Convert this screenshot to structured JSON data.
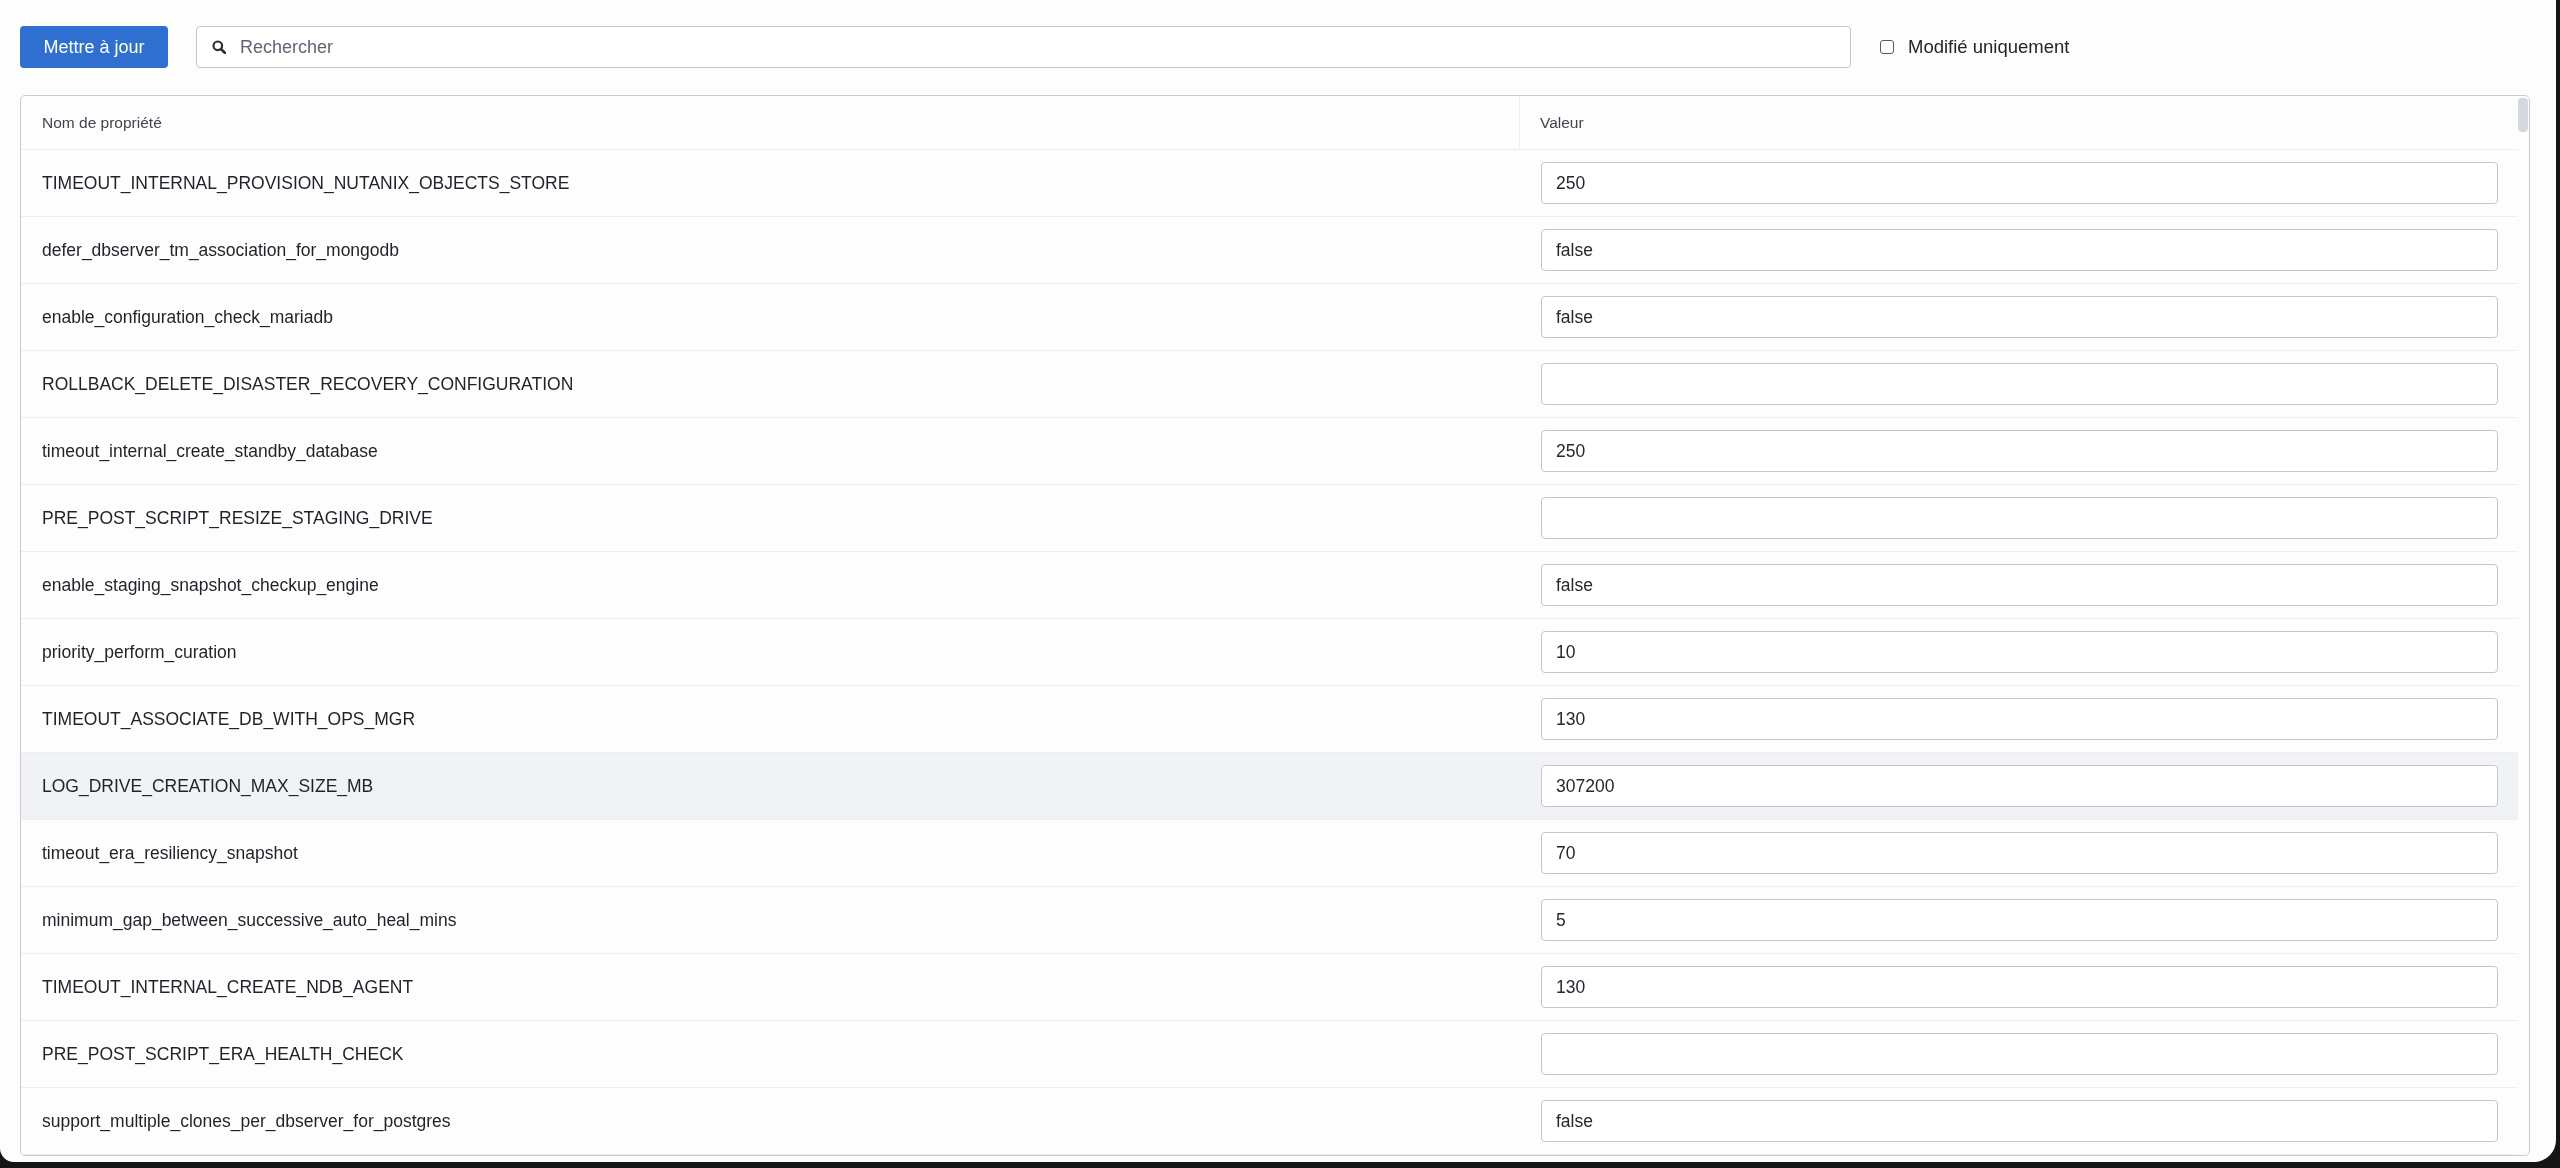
{
  "toolbar": {
    "update_button": "Mettre à jour",
    "search": {
      "placeholder": "Rechercher"
    },
    "modified_only": {
      "label": "Modifié uniquement",
      "checked": false
    }
  },
  "table": {
    "columns": [
      "Nom de propriété",
      "Valeur"
    ],
    "rows": [
      {
        "name": "TIMEOUT_INTERNAL_PROVISION_NUTANIX_OBJECTS_STORE",
        "value": "250",
        "hovered": false
      },
      {
        "name": "defer_dbserver_tm_association_for_mongodb",
        "value": "false",
        "hovered": false
      },
      {
        "name": "enable_configuration_check_mariadb",
        "value": "false",
        "hovered": false
      },
      {
        "name": "ROLLBACK_DELETE_DISASTER_RECOVERY_CONFIGURATION",
        "hovered": false
      },
      {
        "name": "timeout_internal_create_standby_database",
        "value": "250",
        "hovered": false
      },
      {
        "name": "PRE_POST_SCRIPT_RESIZE_STAGING_DRIVE",
        "hovered": false
      },
      {
        "name": "enable_staging_snapshot_checkup_engine",
        "value": "false",
        "hovered": false
      },
      {
        "name": "priority_perform_curation",
        "value": "10",
        "hovered": false
      },
      {
        "name": "TIMEOUT_ASSOCIATE_DB_WITH_OPS_MGR",
        "value": "130",
        "hovered": false
      },
      {
        "name": "LOG_DRIVE_CREATION_MAX_SIZE_MB",
        "value": "307200",
        "hovered": true
      },
      {
        "name": "timeout_era_resiliency_snapshot",
        "value": "70",
        "hovered": false
      },
      {
        "name": "minimum_gap_between_successive_auto_heal_mins",
        "value": "5",
        "hovered": false
      },
      {
        "name": "TIMEOUT_INTERNAL_CREATE_NDB_AGENT",
        "value": "130",
        "hovered": false
      },
      {
        "name": "PRE_POST_SCRIPT_ERA_HEALTH_CHECK",
        "hovered": false
      },
      {
        "name": "support_multiple_clones_per_dbserver_for_postgres",
        "value": "false",
        "hovered": false
      }
    ]
  }
}
